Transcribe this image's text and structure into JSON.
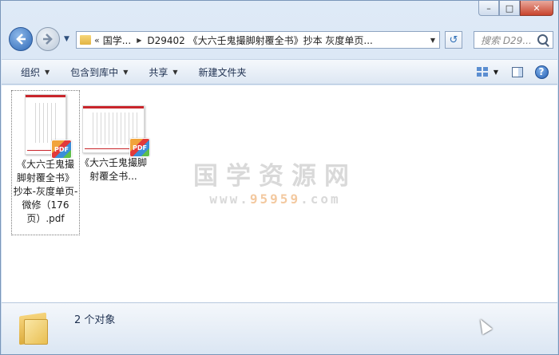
{
  "window": {
    "controls": {
      "minimize": "–",
      "maximize": "□",
      "close": "✕"
    }
  },
  "nav": {
    "dropdown": "▼",
    "address": {
      "overflow": "«",
      "crumbs": [
        "国学...",
        "D29402 《大六壬鬼撮脚射覆全书》抄本 灰度单页..."
      ],
      "separator": "▶",
      "dropdown": "▼"
    },
    "refresh": "↺",
    "search_placeholder": "搜索 D29..."
  },
  "toolbar": {
    "organize": "组织",
    "include_library": "包含到库中",
    "share": "共享",
    "new_folder": "新建文件夹",
    "arrow": "▼",
    "help": "?"
  },
  "files": [
    {
      "name": "《大六壬鬼撮脚射覆全书》抄本-灰度单页-微修（176页）.pdf",
      "badge": "PDF",
      "selected": true,
      "orientation": "portrait"
    },
    {
      "name": "《大六壬鬼撮脚射覆全书...",
      "badge": "PDF",
      "selected": false,
      "orientation": "landscape"
    }
  ],
  "watermark": {
    "title": "国学资源网",
    "url_a": "www.",
    "url_b": "95959",
    "url_c": ".com"
  },
  "status": {
    "count": "2 个对象"
  },
  "colors": {
    "accent_blue": "#2d68b6",
    "close_red": "#c8432c",
    "pdf_red": "#c9252b"
  }
}
